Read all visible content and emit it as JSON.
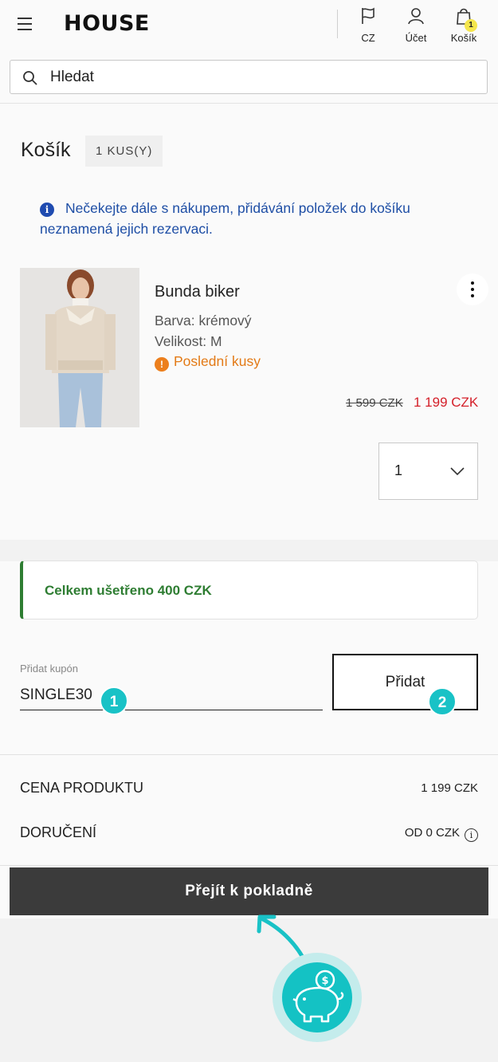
{
  "header": {
    "logo": "HOUSE",
    "country_label": "CZ",
    "account_label": "Účet",
    "cart_label": "Košík",
    "cart_count": "1"
  },
  "search": {
    "placeholder": "Hledat"
  },
  "cart": {
    "title": "Košík",
    "count_badge": "1 KUS(Y)",
    "info_text": "Nečekejte dále s nákupem, přidávání položek do košíku neznamená jejich rezervaci."
  },
  "product": {
    "name": "Bunda biker",
    "color": "Barva: krémový",
    "size": "Velikost: M",
    "status": "Poslední kusy",
    "old_price": "1 599 CZK",
    "new_price": "1 199 CZK",
    "quantity": "1"
  },
  "savings": {
    "text": "Celkem ušetřeno 400 CZK"
  },
  "coupon": {
    "label": "Přidat kupón",
    "value": "SINGLE30",
    "button_label": "Přidat",
    "step1": "1",
    "step2": "2"
  },
  "summary": {
    "product_price_label": "CENA PRODUKTU",
    "product_price_value": "1 199 CZK",
    "delivery_label": "DORUČENÍ",
    "delivery_value": "OD 0 CZK"
  },
  "checkout": {
    "button_label": "Přejít k pokladně"
  },
  "colors": {
    "accent": "#19c2c6",
    "savings": "#2e7d32",
    "sale": "#d4202a",
    "warning": "#e37a16",
    "info": "#1e4ea5"
  }
}
